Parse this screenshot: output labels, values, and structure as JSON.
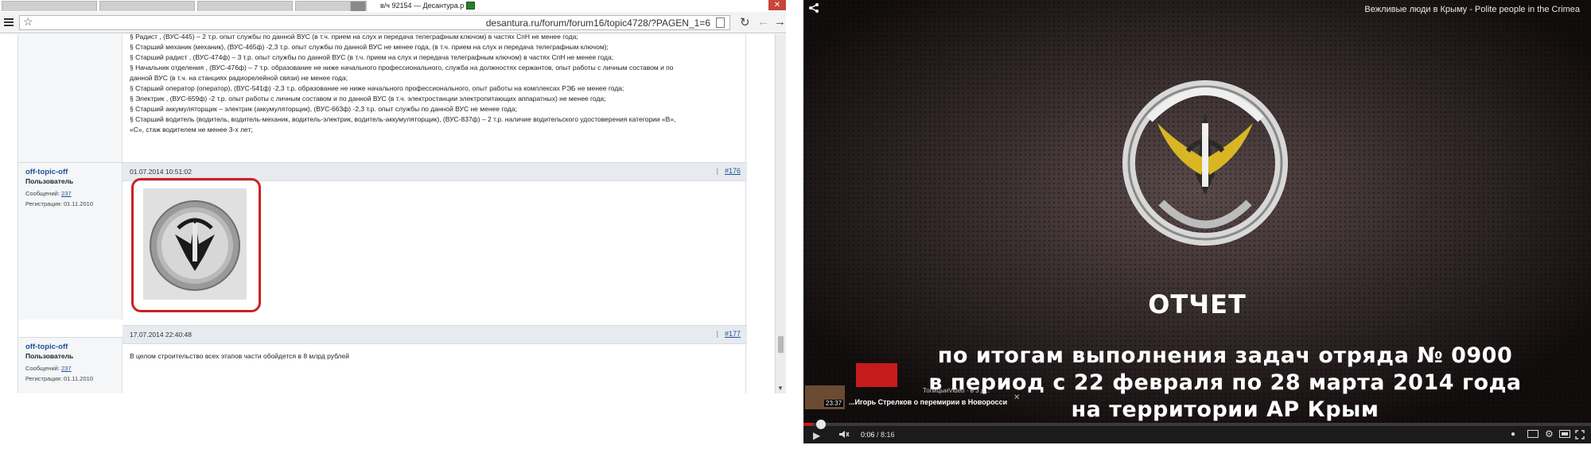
{
  "browser": {
    "tab_title": "в/ч 92154 — Десантура.р",
    "url": "desantura.ru/forum/forum16/topic4728/?PAGEN_1=6",
    "close_symbol": "✕"
  },
  "forum": {
    "top_post_lines": [
      "§ Радист , (ВУС-445) – 2 т.р. опыт службы по данной ВУС (в т.ч. прием на слух и передача телеграфным ключом) в частях СпН не менее года;",
      "§ Старший механик (механик), (ВУС-465ф) -2,3 т.р. опыт службы по данной ВУС не менее года, (в т.ч. прием на слух и передача телеграфным ключом);",
      "§ Старший радист , (ВУС-474ф) – 3 т.р. опыт службы по данной ВУС (в т.ч. прием на слух и передача телеграфным ключом) в частях СпН не менее года;",
      "§ Начальник отделения , (ВУС-476ф) – 7 т.р. образование не ниже начального профессионального, служба на должностях сержантов, опыт работы с личным составом и по",
      "данной ВУС (в т.ч. на станциях радиорелейной связи) не менее года;",
      "§ Старший оператор (оператор), (ВУС-541ф) -2,3 т.р. образование не ниже начального профессионального, опыт работы на комплексах РЭБ не менее года;",
      "§ Электрик , (ВУС-659ф) -2 т.р. опыт работы с личным составом и по данной ВУС (в т.ч. электростанции электропитающих аппаратных) не менее года;",
      "§ Старший аккумуляторщик – электрик (аккумуляторщик), (ВУС-663ф) -2,3 т.р. опыт службы по данной ВУС не менее года;",
      "§ Старший водитель (водитель, водитель-механик, водитель-электрик, водитель-аккумуляторщик), (ВУС-837ф) – 2 т.р. наличие водительского удостоверения категории «В»,",
      "«С», стаж водителем не менее 3-х лет;"
    ],
    "posts": [
      {
        "author": "off-topic-off",
        "role": "Пользователь",
        "messages_label": "Сообщений:",
        "messages_count": "237",
        "reg_label": "Регистрация: 01.11.2010",
        "date": "01.07.2014 10:51:02",
        "sep": "|",
        "number": "#176"
      },
      {
        "author": "off-topic-off",
        "role": "Пользователь",
        "messages_label": "Сообщений:",
        "messages_count": "237",
        "reg_label": "Регистрация: 01.11.2010",
        "date": "17.07.2014 22:40:48",
        "sep": "|",
        "number": "#177",
        "text": "В целом строительство всех этапов части обойдется в 8 млрд рублей"
      }
    ]
  },
  "player": {
    "title": "Вежливые люди в Крыму - Polite people in the Crimea",
    "caption_title": "ОТЧЕТ",
    "caption_line1": "по итогам выполнения задач отряда № 0900",
    "caption_line2": "в период с 22 февраля по 28 марта 2014 года",
    "caption_line3": "на территории АР Крым",
    "suggested_duration": "23:37",
    "suggested_title": "...Игорь Стрелков о перемирии в Новоросси",
    "suggested_channel": "ТопицыиVideo · в 3 д...",
    "suggested_close": "✕",
    "time_current": "0:06",
    "time_sep": " / ",
    "time_total": "8:16",
    "progress_fraction": 0.012,
    "accent_color": "#cc181e"
  }
}
